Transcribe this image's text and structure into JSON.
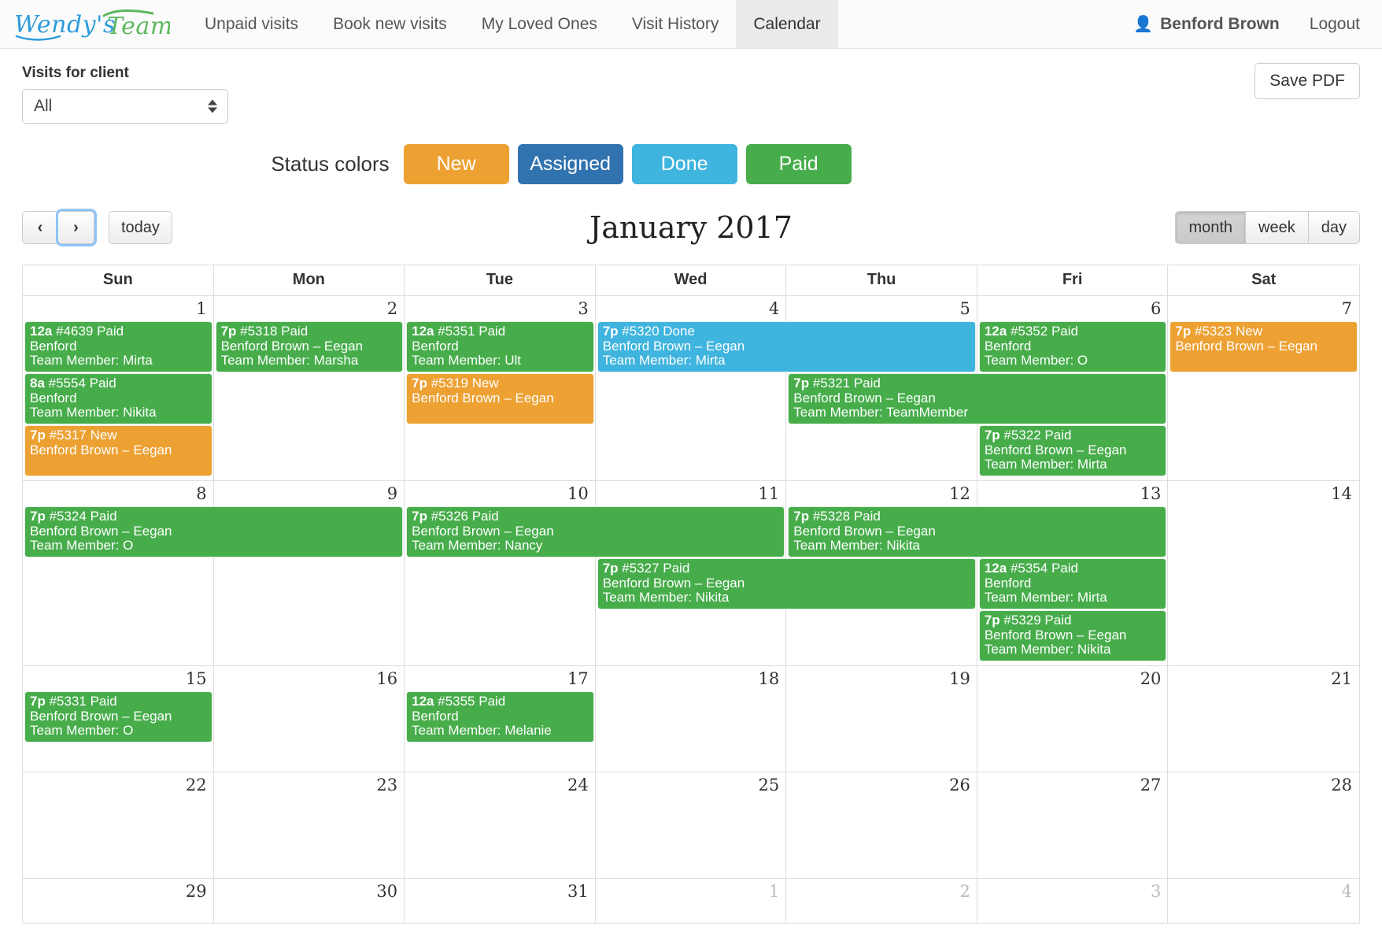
{
  "navbar": {
    "brand": "Wendy's Team",
    "items": [
      {
        "label": "Unpaid visits",
        "active": false
      },
      {
        "label": "Book new visits",
        "active": false
      },
      {
        "label": "My Loved Ones",
        "active": false
      },
      {
        "label": "Visit History",
        "active": false
      },
      {
        "label": "Calendar",
        "active": true
      }
    ],
    "user": "Benford Brown",
    "logout": "Logout"
  },
  "filter": {
    "label": "Visits for client",
    "selected": "All",
    "options": [
      "All"
    ]
  },
  "actions": {
    "save_pdf": "Save PDF"
  },
  "status_colors": {
    "caption": "Status colors",
    "items": [
      {
        "label": "New",
        "color": "#eda133"
      },
      {
        "label": "Assigned",
        "color": "#3173ae"
      },
      {
        "label": "Done",
        "color": "#3fb4de"
      },
      {
        "label": "Paid",
        "color": "#47ad4b"
      }
    ]
  },
  "calendar_toolbar": {
    "prev": "‹",
    "next": "›",
    "today": "today",
    "title": "January 2017",
    "views": [
      {
        "label": "month",
        "active": true
      },
      {
        "label": "week",
        "active": false
      },
      {
        "label": "day",
        "active": false
      }
    ]
  },
  "calendar": {
    "day_headers": [
      "Sun",
      "Mon",
      "Tue",
      "Wed",
      "Thu",
      "Fri",
      "Sat"
    ],
    "weeks": [
      {
        "days": [
          {
            "num": "1",
            "other": false
          },
          {
            "num": "2",
            "other": false
          },
          {
            "num": "3",
            "other": false
          },
          {
            "num": "4",
            "other": false
          },
          {
            "num": "5",
            "other": false
          },
          {
            "num": "6",
            "other": false
          },
          {
            "num": "7",
            "other": false
          }
        ],
        "rows": [
          [
            {
              "col": 0,
              "span": 1,
              "color": "green",
              "time": "12a",
              "id": "#4639",
              "status": "Paid",
              "client": "Benford",
              "member": "Team Member: Mirta"
            },
            {
              "col": 1,
              "span": 1,
              "color": "green",
              "time": "7p",
              "id": "#5318",
              "status": "Paid",
              "client": "Benford Brown – Eegan",
              "member": "Team Member: Marsha"
            },
            {
              "col": 2,
              "span": 1,
              "color": "green",
              "time": "12a",
              "id": "#5351",
              "status": "Paid",
              "client": "Benford",
              "member": "Team Member: Ult"
            },
            {
              "col": 3,
              "span": 2,
              "color": "blue",
              "time": "7p",
              "id": "#5320",
              "status": "Done",
              "client": "Benford Brown – Eegan",
              "member": "Team Member: Mirta"
            },
            {
              "col": 5,
              "span": 1,
              "color": "green",
              "time": "12a",
              "id": "#5352",
              "status": "Paid",
              "client": "Benford",
              "member": "Team Member: O"
            },
            {
              "col": 6,
              "span": 1,
              "color": "orange",
              "time": "7p",
              "id": "#5323",
              "status": "New",
              "client": "Benford Brown – Eegan",
              "member": ""
            }
          ],
          [
            {
              "col": 0,
              "span": 1,
              "color": "green",
              "time": "8a",
              "id": "#5554",
              "status": "Paid",
              "client": "Benford",
              "member": "Team Member: Nikita"
            },
            {
              "col": 2,
              "span": 1,
              "color": "orange",
              "time": "7p",
              "id": "#5319",
              "status": "New",
              "client": "Benford Brown – Eegan",
              "member": ""
            },
            {
              "col": 4,
              "span": 2,
              "color": "green",
              "time": "7p",
              "id": "#5321",
              "status": "Paid",
              "client": "Benford Brown – Eegan",
              "member": "Team Member: TeamMember"
            }
          ],
          [
            {
              "col": 0,
              "span": 1,
              "color": "orange",
              "time": "7p",
              "id": "#5317",
              "status": "New",
              "client": "Benford Brown – Eegan",
              "member": ""
            },
            {
              "col": 5,
              "span": 1,
              "color": "green",
              "time": "7p",
              "id": "#5322",
              "status": "Paid",
              "client": "Benford Brown – Eegan",
              "member": "Team Member: Mirta"
            }
          ]
        ]
      },
      {
        "days": [
          {
            "num": "8",
            "other": false
          },
          {
            "num": "9",
            "other": false
          },
          {
            "num": "10",
            "other": false
          },
          {
            "num": "11",
            "other": false
          },
          {
            "num": "12",
            "other": false
          },
          {
            "num": "13",
            "other": false
          },
          {
            "num": "14",
            "other": false
          }
        ],
        "rows": [
          [
            {
              "col": 0,
              "span": 2,
              "color": "green",
              "time": "7p",
              "id": "#5324",
              "status": "Paid",
              "client": "Benford Brown – Eegan",
              "member": "Team Member: O"
            },
            {
              "col": 2,
              "span": 2,
              "color": "green",
              "time": "7p",
              "id": "#5326",
              "status": "Paid",
              "client": "Benford Brown – Eegan",
              "member": "Team Member: Nancy"
            },
            {
              "col": 4,
              "span": 2,
              "color": "green",
              "time": "7p",
              "id": "#5328",
              "status": "Paid",
              "client": "Benford Brown – Eegan",
              "member": "Team Member: Nikita"
            }
          ],
          [
            {
              "col": 3,
              "span": 2,
              "color": "green",
              "time": "7p",
              "id": "#5327",
              "status": "Paid",
              "client": "Benford Brown – Eegan",
              "member": "Team Member: Nikita"
            },
            {
              "col": 5,
              "span": 1,
              "color": "green",
              "time": "12a",
              "id": "#5354",
              "status": "Paid",
              "client": "Benford",
              "member": "Team Member: Mirta"
            }
          ],
          [
            {
              "col": 5,
              "span": 1,
              "color": "green",
              "time": "7p",
              "id": "#5329",
              "status": "Paid",
              "client": "Benford Brown – Eegan",
              "member": "Team Member: Nikita"
            }
          ]
        ]
      },
      {
        "days": [
          {
            "num": "15",
            "other": false
          },
          {
            "num": "16",
            "other": false
          },
          {
            "num": "17",
            "other": false
          },
          {
            "num": "18",
            "other": false
          },
          {
            "num": "19",
            "other": false
          },
          {
            "num": "20",
            "other": false
          },
          {
            "num": "21",
            "other": false
          }
        ],
        "rows": [
          [
            {
              "col": 0,
              "span": 1,
              "color": "green",
              "time": "7p",
              "id": "#5331",
              "status": "Paid",
              "client": "Benford Brown – Eegan",
              "member": "Team Member: O"
            },
            {
              "col": 2,
              "span": 1,
              "color": "green",
              "time": "12a",
              "id": "#5355",
              "status": "Paid",
              "client": "Benford",
              "member": "Team Member: Melanie"
            }
          ]
        ]
      },
      {
        "days": [
          {
            "num": "22",
            "other": false
          },
          {
            "num": "23",
            "other": false
          },
          {
            "num": "24",
            "other": false
          },
          {
            "num": "25",
            "other": false
          },
          {
            "num": "26",
            "other": false
          },
          {
            "num": "27",
            "other": false
          },
          {
            "num": "28",
            "other": false
          }
        ],
        "rows": []
      },
      {
        "days": [
          {
            "num": "29",
            "other": false
          },
          {
            "num": "30",
            "other": false
          },
          {
            "num": "31",
            "other": false
          },
          {
            "num": "1",
            "other": true
          },
          {
            "num": "2",
            "other": true
          },
          {
            "num": "3",
            "other": true
          },
          {
            "num": "4",
            "other": true
          }
        ],
        "rows": []
      }
    ]
  }
}
